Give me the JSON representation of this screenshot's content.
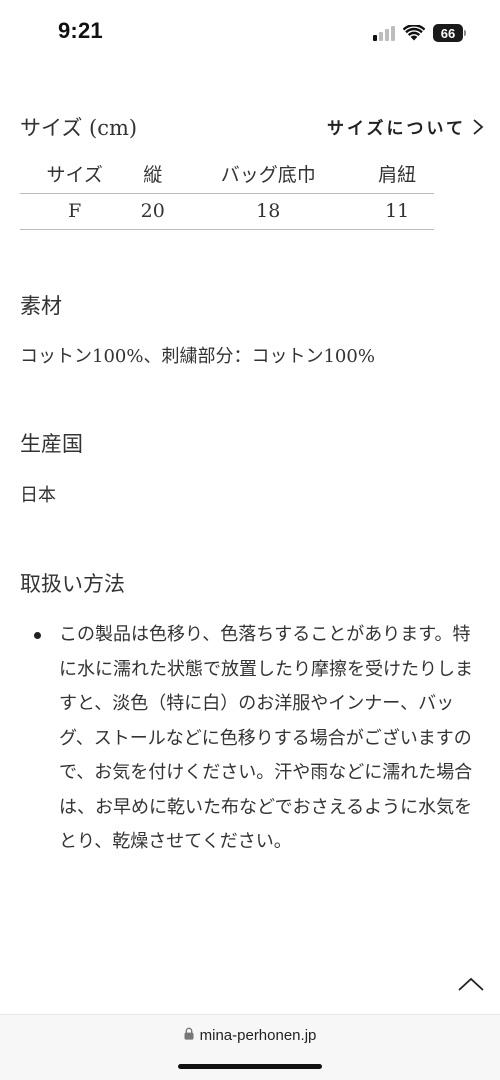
{
  "status_bar": {
    "time": "9:21",
    "battery": "66"
  },
  "size_section": {
    "title": "サイズ (cm)",
    "about_link": "サイズについて",
    "table": {
      "headers": [
        "サイズ",
        "縦",
        "バッグ底巾",
        "肩紐"
      ],
      "rows": [
        [
          "F",
          "20",
          "18",
          "11"
        ]
      ]
    }
  },
  "material": {
    "title": "素材",
    "text": "コットン100%、刺繍部分：コットン100%"
  },
  "origin": {
    "title": "生産国",
    "text": "日本"
  },
  "care": {
    "title": "取扱い方法",
    "items": [
      "この製品は色移り、色落ちすることがあります。特に水に濡れた状態で放置したり摩擦を受けたりしますと、淡色（特に白）のお洋服やインナー、バッグ、ストールなどに色移りする場合がございますので、お気を付けください。汗や雨などに濡れた場合は、お早めに乾いた布などでおさえるように水気をとり、乾燥させてください。"
    ]
  },
  "browser": {
    "url": "mina-perhonen.jp"
  },
  "icons": {
    "signal": "cellular-signal-icon",
    "wifi": "wifi-icon",
    "battery": "battery-icon",
    "chevron": "chevron-right-icon",
    "scroll_top": "chevron-up-icon",
    "lock": "lock-icon"
  }
}
